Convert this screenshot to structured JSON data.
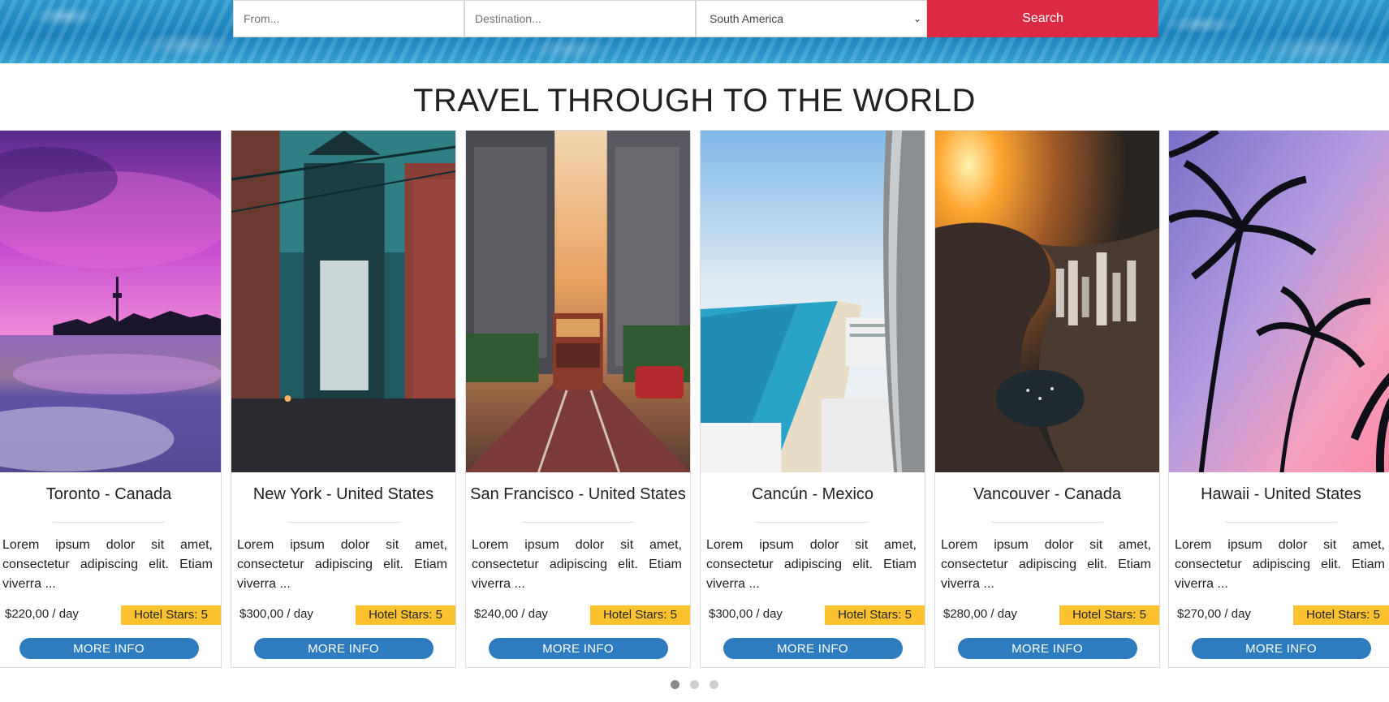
{
  "search": {
    "from_placeholder": "From...",
    "destination_placeholder": "Destination...",
    "region_selected": "South America",
    "button_label": "Search",
    "button_color": "#dc2a44"
  },
  "heading": "TRAVEL THROUGH TO THE WORLD",
  "cards": [
    {
      "city": "Toronto - Canada",
      "desc": "Lorem ipsum dolor sit amet, consectetur adipiscing elit. Etiam viverra ...",
      "price": "$220,00 / day",
      "stars": "Hotel Stars: 5",
      "button": "MORE INFO"
    },
    {
      "city": "New York - United States",
      "desc": "Lorem ipsum dolor sit amet, consectetur adipiscing elit. Etiam viverra ...",
      "price": "$300,00 / day",
      "stars": "Hotel Stars: 5",
      "button": "MORE INFO"
    },
    {
      "city": "San Francisco - United States",
      "desc": "Lorem ipsum dolor sit amet, consectetur adipiscing elit. Etiam viverra ...",
      "price": "$240,00 / day",
      "stars": "Hotel Stars: 5",
      "button": "MORE INFO"
    },
    {
      "city": "Cancún - Mexico",
      "desc": "Lorem ipsum dolor sit amet, consectetur adipiscing elit. Etiam viverra ...",
      "price": "$300,00 / day",
      "stars": "Hotel Stars: 5",
      "button": "MORE INFO"
    },
    {
      "city": "Vancouver - Canada",
      "desc": "Lorem ipsum dolor sit amet, consectetur adipiscing elit. Etiam viverra ...",
      "price": "$280,00 / day",
      "stars": "Hotel Stars: 5",
      "button": "MORE INFO"
    },
    {
      "city": "Hawaii - United States",
      "desc": "Lorem ipsum dolor sit amet, consectetur adipiscing elit. Etiam viverra ...",
      "price": "$270,00 / day",
      "stars": "Hotel Stars: 5",
      "button": "MORE INFO"
    }
  ],
  "carousel": {
    "page_count": 3,
    "active_page": 1
  },
  "colors": {
    "stars_badge": "#f9c22e",
    "more_info_button": "#2e7cbf"
  }
}
